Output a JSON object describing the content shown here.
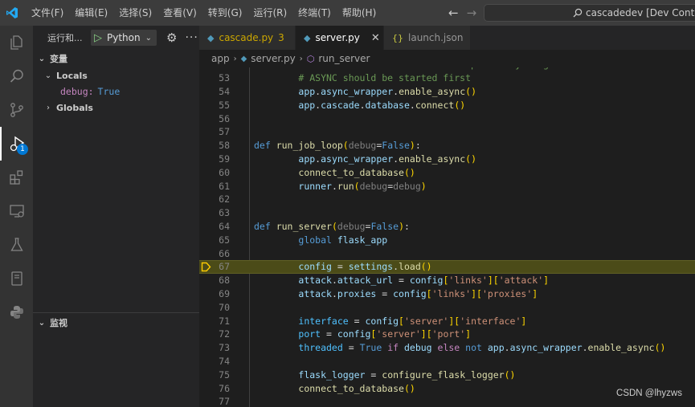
{
  "window": {
    "menu": [
      "文件(F)",
      "编辑(E)",
      "选择(S)",
      "查看(V)",
      "转到(G)",
      "运行(R)",
      "终端(T)",
      "帮助(H)"
    ],
    "search_text": "cascadedev [Dev Container: li",
    "accent_color": "#0078d4"
  },
  "activity_bar": {
    "items": [
      "explorer-icon",
      "search-icon",
      "source-control-icon",
      "run-debug-icon",
      "extensions-icon",
      "remote-explorer-icon",
      "testing-icon",
      "containers-icon",
      "python-icon"
    ],
    "debug_badge": "1"
  },
  "sidebar": {
    "header_title": "运行和...",
    "run_config": "Python",
    "variables_title": "变量",
    "locals_label": "Locals",
    "debug_var_name": "debug:",
    "debug_var_value": "True",
    "globals_label": "Globals",
    "watch_title": "监视"
  },
  "tabs": [
    {
      "label": "cascade.py",
      "modified": "3",
      "active": false
    },
    {
      "label": "server.py",
      "active": true
    },
    {
      "label": "launch.json",
      "active": false
    }
  ],
  "breadcrumb": [
    "app",
    "server.py",
    "run_server"
  ],
  "editor": {
    "current_line": 67,
    "lines": [
      {
        "n": "52",
        "t": [
          [
            "        ",
            "plain"
          ],
          [
            "# Connect to the database and update anything that needs to be",
            "cm"
          ]
        ]
      },
      {
        "n": "53",
        "t": [
          [
            "        ",
            "plain"
          ],
          [
            "# ASYNC should be started first",
            "cm"
          ]
        ]
      },
      {
        "n": "54",
        "t": [
          [
            "        ",
            "plain"
          ],
          [
            "app",
            "var"
          ],
          [
            ".",
            "plain"
          ],
          [
            "async_wrapper",
            "var"
          ],
          [
            ".",
            "plain"
          ],
          [
            "enable_async",
            "fn"
          ],
          [
            "()",
            "p1"
          ]
        ]
      },
      {
        "n": "55",
        "t": [
          [
            "        ",
            "plain"
          ],
          [
            "app",
            "var"
          ],
          [
            ".",
            "plain"
          ],
          [
            "cascade",
            "var"
          ],
          [
            ".",
            "plain"
          ],
          [
            "database",
            "var"
          ],
          [
            ".",
            "plain"
          ],
          [
            "connect",
            "fn"
          ],
          [
            "()",
            "p1"
          ]
        ]
      },
      {
        "n": "56",
        "t": []
      },
      {
        "n": "57",
        "t": []
      },
      {
        "n": "58",
        "t": [
          [
            "def ",
            "kw"
          ],
          [
            "run_job_loop",
            "fn"
          ],
          [
            "(",
            "p1"
          ],
          [
            "debug",
            "pm"
          ],
          [
            "=",
            "plain"
          ],
          [
            "False",
            "kw"
          ],
          [
            ")",
            "p1"
          ],
          [
            ":",
            "plain"
          ]
        ]
      },
      {
        "n": "59",
        "t": [
          [
            "        ",
            "plain"
          ],
          [
            "app",
            "var"
          ],
          [
            ".",
            "plain"
          ],
          [
            "async_wrapper",
            "var"
          ],
          [
            ".",
            "plain"
          ],
          [
            "enable_async",
            "fn"
          ],
          [
            "()",
            "p1"
          ]
        ]
      },
      {
        "n": "60",
        "t": [
          [
            "        ",
            "plain"
          ],
          [
            "connect_to_database",
            "fn"
          ],
          [
            "()",
            "p1"
          ]
        ]
      },
      {
        "n": "61",
        "t": [
          [
            "        ",
            "plain"
          ],
          [
            "runner",
            "var"
          ],
          [
            ".",
            "plain"
          ],
          [
            "run",
            "fn"
          ],
          [
            "(",
            "p1"
          ],
          [
            "debug",
            "pm"
          ],
          [
            "=",
            "plain"
          ],
          [
            "debug",
            "pm"
          ],
          [
            ")",
            "p1"
          ]
        ]
      },
      {
        "n": "62",
        "t": []
      },
      {
        "n": "63",
        "t": []
      },
      {
        "n": "64",
        "t": [
          [
            "def ",
            "kw"
          ],
          [
            "run_server",
            "fn"
          ],
          [
            "(",
            "p1"
          ],
          [
            "debug",
            "pm"
          ],
          [
            "=",
            "plain"
          ],
          [
            "False",
            "kw"
          ],
          [
            ")",
            "p1"
          ],
          [
            ":",
            "plain"
          ]
        ]
      },
      {
        "n": "65",
        "t": [
          [
            "        ",
            "plain"
          ],
          [
            "global ",
            "kw"
          ],
          [
            "flask_app",
            "var"
          ]
        ]
      },
      {
        "n": "66",
        "t": []
      },
      {
        "n": "67",
        "t": [
          [
            "        ",
            "plain"
          ],
          [
            "config",
            "var"
          ],
          [
            " = ",
            "plain"
          ],
          [
            "settings",
            "var"
          ],
          [
            ".",
            "plain"
          ],
          [
            "load",
            "fn"
          ],
          [
            "()",
            "p1"
          ]
        ]
      },
      {
        "n": "68",
        "t": [
          [
            "        ",
            "plain"
          ],
          [
            "attack",
            "var"
          ],
          [
            ".",
            "plain"
          ],
          [
            "attack_url",
            "var"
          ],
          [
            " = ",
            "plain"
          ],
          [
            "config",
            "var"
          ],
          [
            "[",
            "p1"
          ],
          [
            "'links'",
            "str"
          ],
          [
            "]",
            "p1"
          ],
          [
            "[",
            "p1"
          ],
          [
            "'attack'",
            "str"
          ],
          [
            "]",
            "p1"
          ]
        ]
      },
      {
        "n": "69",
        "t": [
          [
            "        ",
            "plain"
          ],
          [
            "attack",
            "var"
          ],
          [
            ".",
            "plain"
          ],
          [
            "proxies",
            "var"
          ],
          [
            " = ",
            "plain"
          ],
          [
            "config",
            "var"
          ],
          [
            "[",
            "p1"
          ],
          [
            "'links'",
            "str"
          ],
          [
            "]",
            "p1"
          ],
          [
            "[",
            "p1"
          ],
          [
            "'proxies'",
            "str"
          ],
          [
            "]",
            "p1"
          ]
        ]
      },
      {
        "n": "70",
        "t": []
      },
      {
        "n": "71",
        "t": [
          [
            "        ",
            "plain"
          ],
          [
            "interface",
            "con"
          ],
          [
            " = ",
            "plain"
          ],
          [
            "config",
            "var"
          ],
          [
            "[",
            "p1"
          ],
          [
            "'server'",
            "str"
          ],
          [
            "]",
            "p1"
          ],
          [
            "[",
            "p1"
          ],
          [
            "'interface'",
            "str"
          ],
          [
            "]",
            "p1"
          ]
        ]
      },
      {
        "n": "72",
        "t": [
          [
            "        ",
            "plain"
          ],
          [
            "port",
            "con"
          ],
          [
            " = ",
            "plain"
          ],
          [
            "config",
            "var"
          ],
          [
            "[",
            "p1"
          ],
          [
            "'server'",
            "str"
          ],
          [
            "]",
            "p1"
          ],
          [
            "[",
            "p1"
          ],
          [
            "'port'",
            "str"
          ],
          [
            "]",
            "p1"
          ]
        ]
      },
      {
        "n": "73",
        "t": [
          [
            "        ",
            "plain"
          ],
          [
            "threaded",
            "con"
          ],
          [
            " = ",
            "plain"
          ],
          [
            "True ",
            "kw"
          ],
          [
            "if ",
            "ctl"
          ],
          [
            "debug ",
            "var"
          ],
          [
            "else ",
            "ctl"
          ],
          [
            "not ",
            "kw"
          ],
          [
            "app",
            "var"
          ],
          [
            ".",
            "plain"
          ],
          [
            "async_wrapper",
            "var"
          ],
          [
            ".",
            "plain"
          ],
          [
            "enable_async",
            "fn"
          ],
          [
            "()",
            "p1"
          ]
        ]
      },
      {
        "n": "74",
        "t": []
      },
      {
        "n": "75",
        "t": [
          [
            "        ",
            "plain"
          ],
          [
            "flask_logger",
            "var"
          ],
          [
            " = ",
            "plain"
          ],
          [
            "configure_flask_logger",
            "fn"
          ],
          [
            "()",
            "p1"
          ]
        ]
      },
      {
        "n": "76",
        "t": [
          [
            "        ",
            "plain"
          ],
          [
            "connect_to_database",
            "fn"
          ],
          [
            "()",
            "p1"
          ]
        ]
      },
      {
        "n": "77",
        "t": []
      }
    ]
  },
  "watermark": "CSDN @lhyzws"
}
